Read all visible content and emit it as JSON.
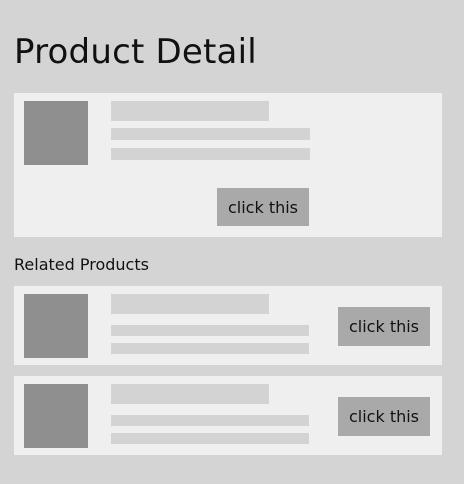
{
  "page": {
    "title": "Product Detail"
  },
  "main_card": {
    "button_label": "click this"
  },
  "related": {
    "heading": "Related Products",
    "items": [
      {
        "button_label": "click this"
      },
      {
        "button_label": "click this"
      }
    ]
  },
  "colors": {
    "background": "#d4d4d4",
    "card": "#efefef",
    "thumbnail": "#8f8f8f",
    "placeholder": "#d3d3d3",
    "button": "#a9a9a9"
  }
}
